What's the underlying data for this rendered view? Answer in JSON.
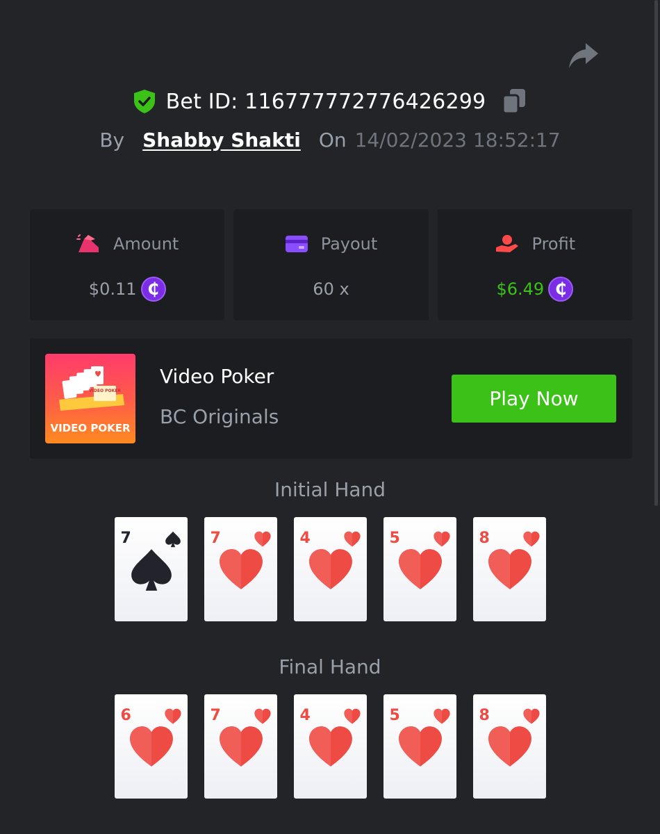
{
  "bet": {
    "id_label": "Bet ID: 116777772776426299",
    "by_label": "By",
    "username": "Shabby Shakti",
    "on_label": "On",
    "datetime": "14/02/2023 18:52:17"
  },
  "stats": {
    "amount": {
      "label": "Amount",
      "value": "$0.11",
      "icon": "bet-amount-icon",
      "currency_symbol": "₵"
    },
    "payout": {
      "label": "Payout",
      "value": "60 x",
      "icon": "card-icon"
    },
    "profit": {
      "label": "Profit",
      "value": "$6.49",
      "icon": "hand-coin-icon",
      "currency_symbol": "₵"
    }
  },
  "game": {
    "title": "Video Poker",
    "subtitle": "BC Originals",
    "thumb_text": "VIDEO POKER",
    "thumb_small_text": "VIDEO POKER",
    "play_label": "Play Now"
  },
  "initial_hand": {
    "title": "Initial Hand",
    "cards": [
      {
        "rank": "7",
        "suit": "spade"
      },
      {
        "rank": "7",
        "suit": "heart"
      },
      {
        "rank": "4",
        "suit": "heart"
      },
      {
        "rank": "5",
        "suit": "heart"
      },
      {
        "rank": "8",
        "suit": "heart"
      }
    ]
  },
  "final_hand": {
    "title": "Final Hand",
    "cards": [
      {
        "rank": "6",
        "suit": "heart"
      },
      {
        "rank": "7",
        "suit": "heart"
      },
      {
        "rank": "4",
        "suit": "heart"
      },
      {
        "rank": "5",
        "suit": "heart"
      },
      {
        "rank": "8",
        "suit": "heart"
      }
    ]
  },
  "colors": {
    "background": "#232428",
    "panel": "#1c1d21",
    "accent_green": "#3bc117",
    "heart_red": "#ee4b45",
    "coin_purple": "#7b2de6",
    "shield_green": "#3bc117"
  }
}
